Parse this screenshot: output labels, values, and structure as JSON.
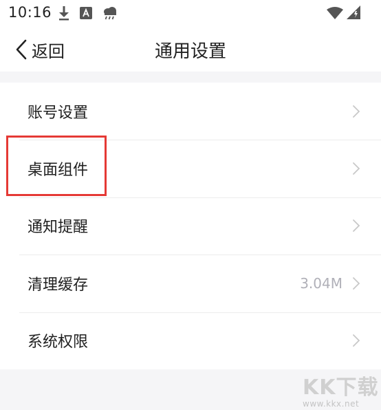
{
  "status_bar": {
    "time": "10:16",
    "icons": [
      "download-icon",
      "font-a-icon",
      "weather-rain-icon",
      "wifi-icon",
      "cellular-signal-icon"
    ]
  },
  "nav": {
    "back_label": "返回",
    "title": "通用设置"
  },
  "list": {
    "items": [
      {
        "label": "账号设置",
        "value": ""
      },
      {
        "label": "桌面组件",
        "value": ""
      },
      {
        "label": "通知提醒",
        "value": ""
      },
      {
        "label": "清理缓存",
        "value": "3.04M"
      },
      {
        "label": "系统权限",
        "value": ""
      }
    ]
  },
  "annotation": {
    "highlight_color": "#e53935",
    "highlighted_item": "桌面组件"
  },
  "watermark": {
    "main": "KK下载",
    "url": "www.kkx.net"
  },
  "colors": {
    "background": "#f5f5f7",
    "surface": "#ffffff",
    "secondary_text": "#b0b0b8",
    "chevron": "#c8c8c8"
  }
}
